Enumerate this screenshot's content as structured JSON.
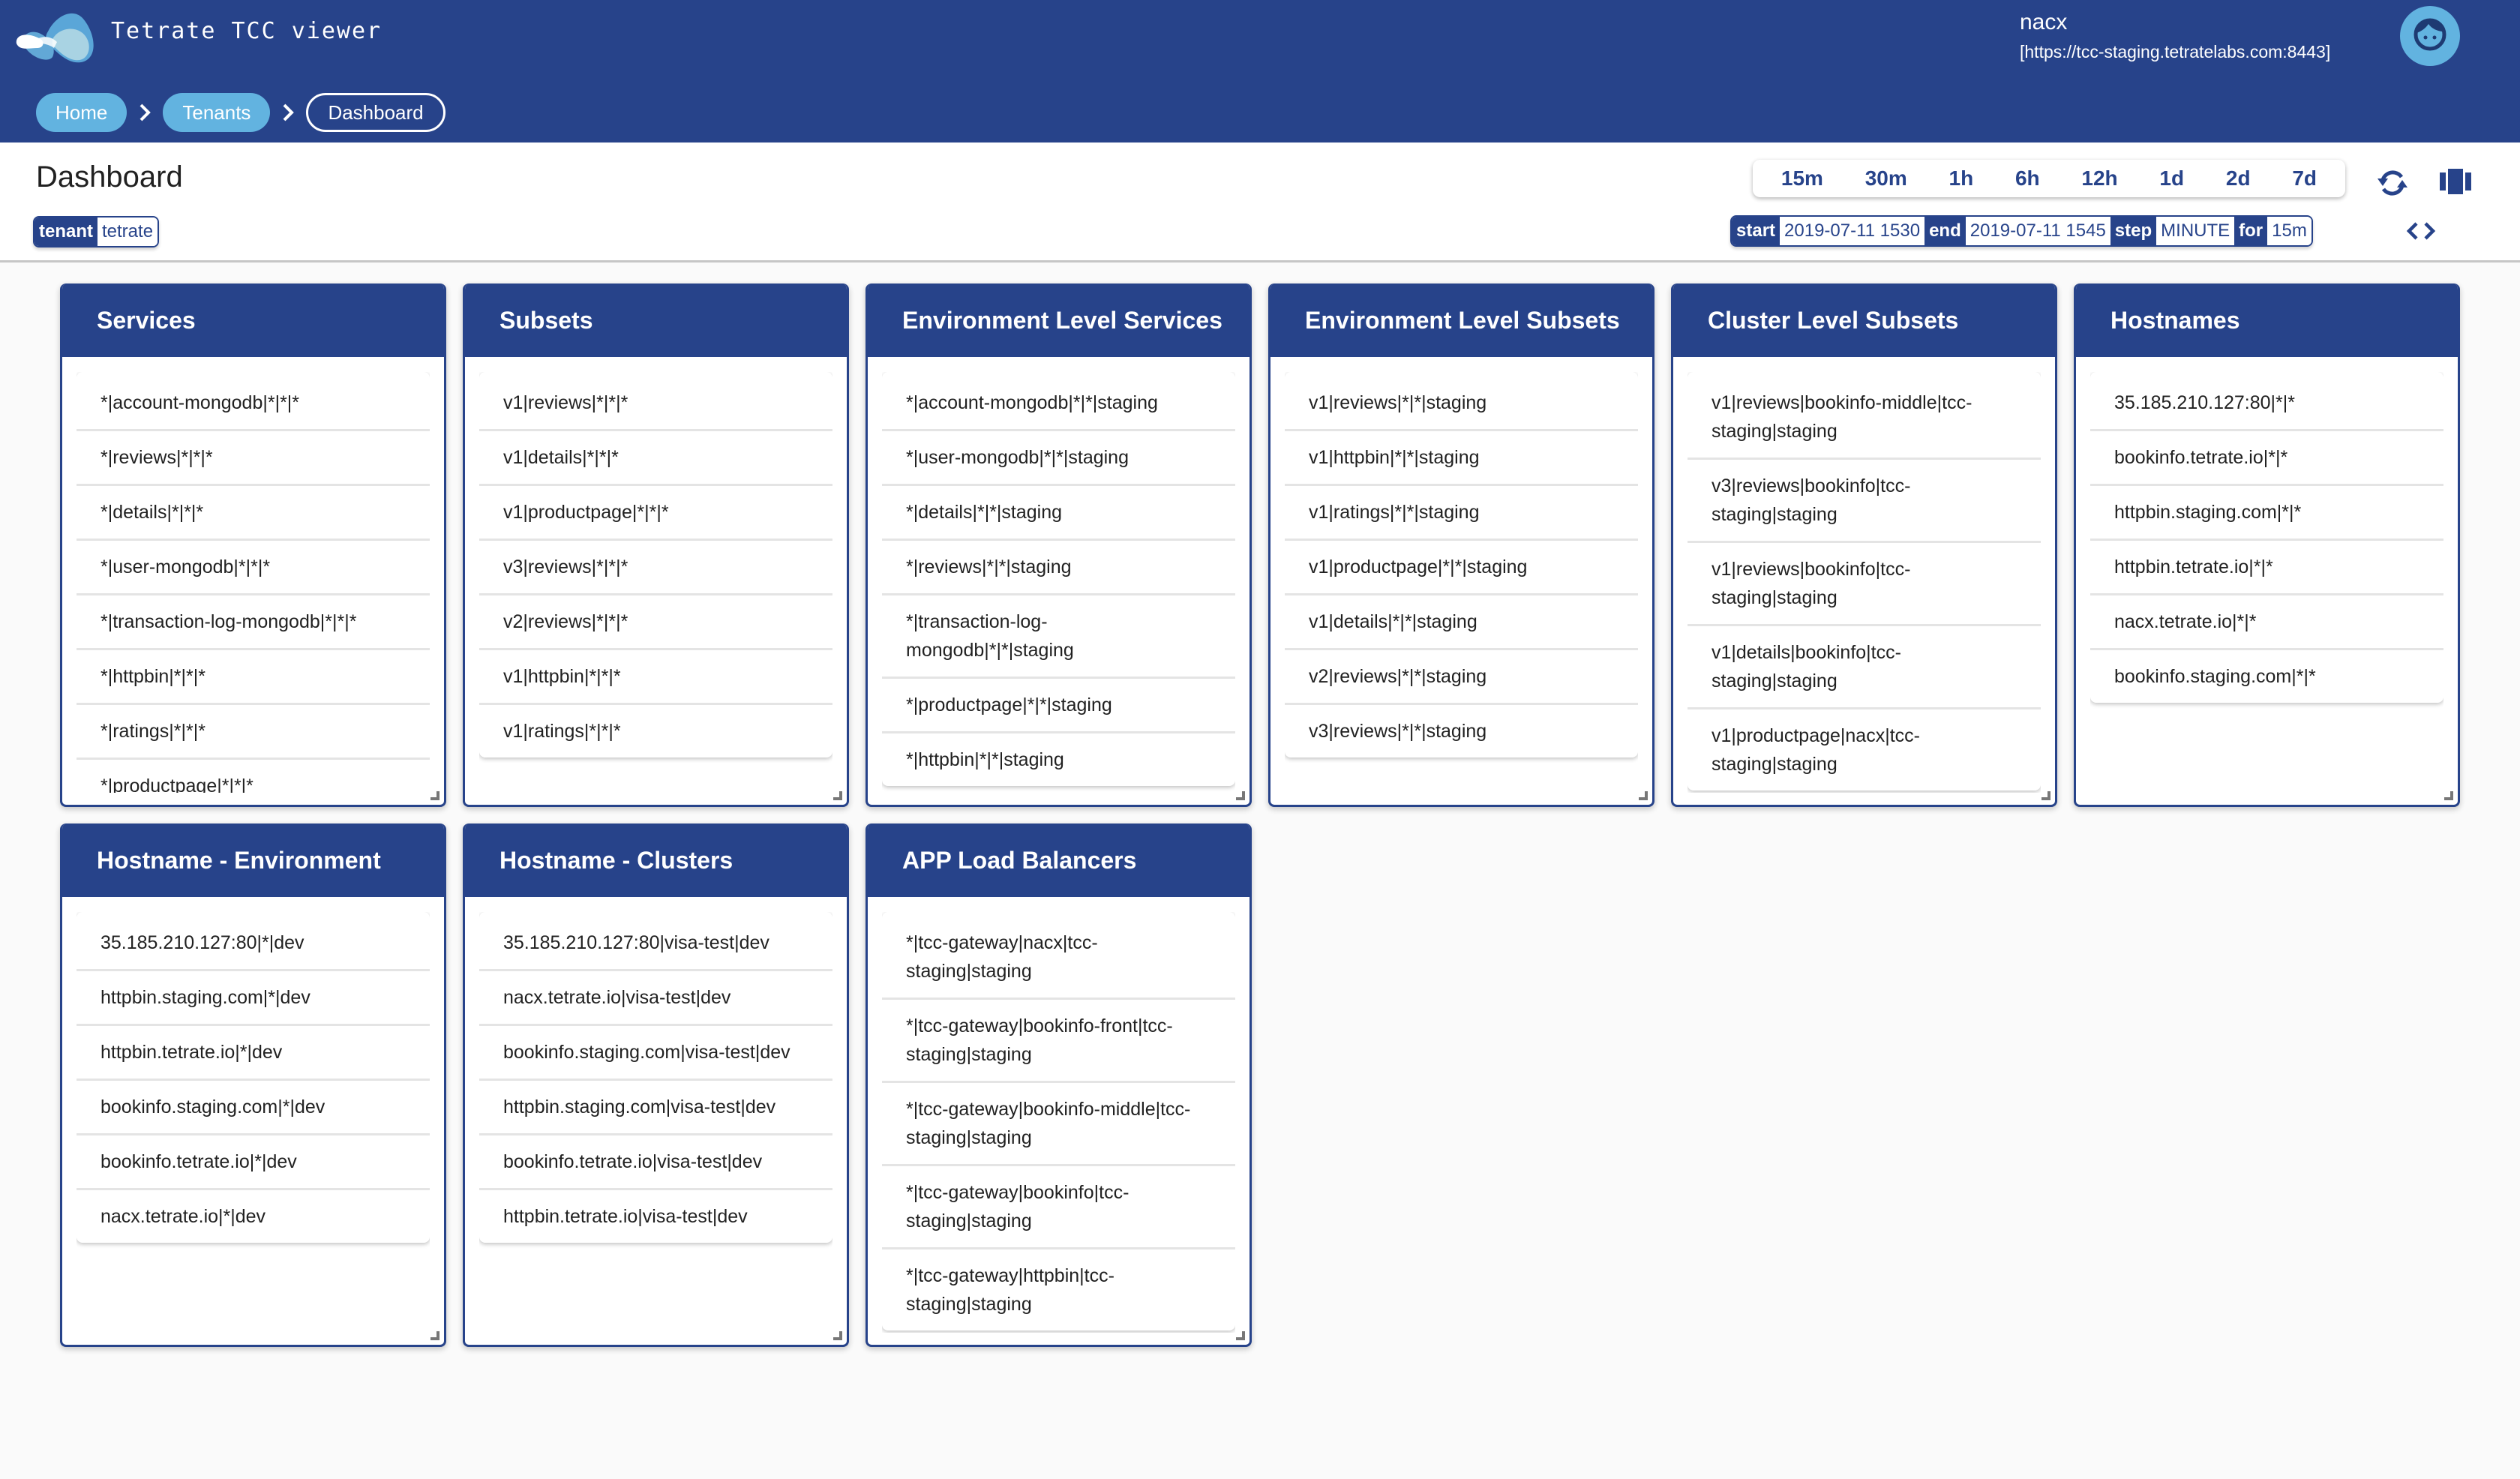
{
  "app": {
    "title": "Tetrate TCC viewer",
    "logo_icon": "tetrate-logo-icon",
    "user_name": "nacx",
    "server_url": "[https://tcc-staging.tetratelabs.com:8443]",
    "avatar_icon": "face-icon"
  },
  "colors": {
    "primary": "#27438a",
    "accent": "#62b3e0",
    "background": "#fafafa"
  },
  "breadcrumbs": [
    {
      "label": "Home"
    },
    {
      "label": "Tenants"
    },
    {
      "label": "Dashboard"
    }
  ],
  "page": {
    "title": "Dashboard",
    "tenant_key": "tenant",
    "tenant_value": "tetrate"
  },
  "time_ranges": [
    "15m",
    "30m",
    "1h",
    "6h",
    "12h",
    "1d",
    "2d",
    "7d"
  ],
  "range": {
    "start_label": "start",
    "start_value": "2019-07-11 1530",
    "end_label": "end",
    "end_value": "2019-07-11 1545",
    "step_label": "step",
    "step_value": "MINUTE",
    "for_label": "for",
    "for_value": "15m"
  },
  "toolbar": {
    "refresh_icon": "refresh-icon",
    "layout_icon": "view-carousel-icon",
    "code_icon": "code-icon"
  },
  "cards": [
    {
      "title": "Services",
      "items": [
        "*|account-mongodb|*|*|*",
        "*|reviews|*|*|*",
        "*|details|*|*|*",
        "*|user-mongodb|*|*|*",
        "*|transaction-log-mongodb|*|*|*",
        "*|httpbin|*|*|*",
        "*|ratings|*|*|*",
        "*|productpage|*|*|*"
      ]
    },
    {
      "title": "Subsets",
      "items": [
        "v1|reviews|*|*|*",
        "v1|details|*|*|*",
        "v1|productpage|*|*|*",
        "v3|reviews|*|*|*",
        "v2|reviews|*|*|*",
        "v1|httpbin|*|*|*",
        "v1|ratings|*|*|*"
      ]
    },
    {
      "title": "Environment Level Services",
      "items": [
        "*|account-mongodb|*|*|staging",
        "*|user-mongodb|*|*|staging",
        "*|details|*|*|staging",
        "*|reviews|*|*|staging",
        "*|transaction-log-mongodb|*|*|staging",
        "*|productpage|*|*|staging",
        "*|httpbin|*|*|staging"
      ]
    },
    {
      "title": "Environment Level Subsets",
      "items": [
        "v1|reviews|*|*|staging",
        "v1|httpbin|*|*|staging",
        "v1|ratings|*|*|staging",
        "v1|productpage|*|*|staging",
        "v1|details|*|*|staging",
        "v2|reviews|*|*|staging",
        "v3|reviews|*|*|staging"
      ]
    },
    {
      "title": "Cluster Level Subsets",
      "items": [
        "v1|reviews|bookinfo-middle|tcc-staging|staging",
        "v3|reviews|bookinfo|tcc-staging|staging",
        "v1|reviews|bookinfo|tcc-staging|staging",
        "v1|details|bookinfo|tcc-staging|staging",
        "v1|productpage|nacx|tcc-staging|staging"
      ]
    },
    {
      "title": "Hostnames",
      "items": [
        "35.185.210.127:80|*|*",
        "bookinfo.tetrate.io|*|*",
        "httpbin.staging.com|*|*",
        "httpbin.tetrate.io|*|*",
        "nacx.tetrate.io|*|*",
        "bookinfo.staging.com|*|*"
      ]
    },
    {
      "title": "Hostname - Environment",
      "items": [
        "35.185.210.127:80|*|dev",
        "httpbin.staging.com|*|dev",
        "httpbin.tetrate.io|*|dev",
        "bookinfo.staging.com|*|dev",
        "bookinfo.tetrate.io|*|dev",
        "nacx.tetrate.io|*|dev"
      ]
    },
    {
      "title": "Hostname - Clusters",
      "items": [
        "35.185.210.127:80|visa-test|dev",
        "nacx.tetrate.io|visa-test|dev",
        "bookinfo.staging.com|visa-test|dev",
        "httpbin.staging.com|visa-test|dev",
        "bookinfo.tetrate.io|visa-test|dev",
        "httpbin.tetrate.io|visa-test|dev"
      ]
    },
    {
      "title": "APP Load Balancers",
      "items": [
        "*|tcc-gateway|nacx|tcc-staging|staging",
        "*|tcc-gateway|bookinfo-front|tcc-staging|staging",
        "*|tcc-gateway|bookinfo-middle|tcc-staging|staging",
        "*|tcc-gateway|bookinfo|tcc-staging|staging",
        "*|tcc-gateway|httpbin|tcc-staging|staging"
      ]
    }
  ]
}
